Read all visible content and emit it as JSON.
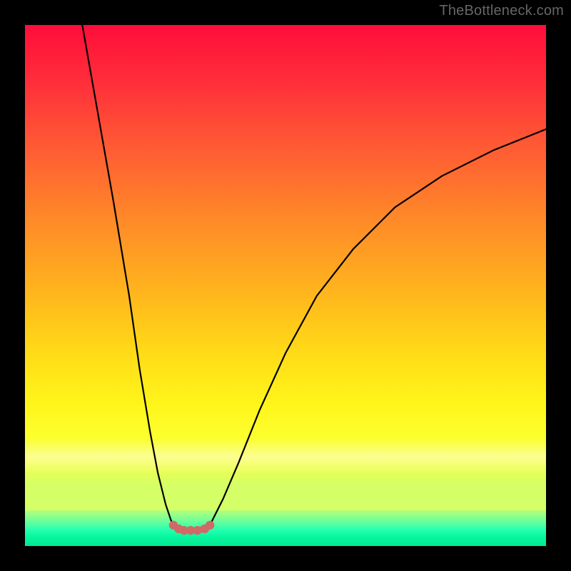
{
  "watermark": "TheBottleneck.com",
  "chart_data": {
    "type": "line",
    "title": "",
    "xlabel": "",
    "ylabel": "",
    "xlim": [
      0,
      100
    ],
    "ylim": [
      0,
      100
    ],
    "grid": false,
    "legend": null,
    "series": [
      {
        "name": "left_branch",
        "x": [
          11,
          14,
          17,
          20,
          22,
          24,
          25.5,
          27,
          28,
          28.5
        ],
        "y": [
          100,
          83,
          66,
          48,
          34,
          22,
          14,
          8,
          5,
          4
        ]
      },
      {
        "name": "valley",
        "x": [
          28.5,
          29.5,
          30.5,
          31.8,
          33.1,
          34.5,
          35.5
        ],
        "y": [
          4,
          3.3,
          3.0,
          3.0,
          3.0,
          3.3,
          4
        ]
      },
      {
        "name": "right_branch",
        "x": [
          35.5,
          38,
          41,
          45,
          50,
          56,
          63,
          71,
          80,
          90,
          100
        ],
        "y": [
          4,
          9,
          16,
          26,
          37,
          48,
          57,
          65,
          71,
          76,
          80
        ]
      }
    ],
    "highlight": {
      "name": "valley_marker",
      "color": "#cf6a66",
      "x": [
        28.5,
        29.5,
        30.5,
        31.8,
        33.1,
        34.5,
        35.5
      ],
      "y": [
        4,
        3.3,
        3.0,
        3.0,
        3.0,
        3.3,
        4
      ]
    },
    "background": {
      "type": "vertical_gradient",
      "stops": [
        {
          "pos": 0,
          "color": "#ff0d3a"
        },
        {
          "pos": 55,
          "color": "#ffb51d"
        },
        {
          "pos": 85,
          "color": "#fdff2e"
        },
        {
          "pos": 100,
          "color": "#03e892"
        }
      ]
    }
  }
}
